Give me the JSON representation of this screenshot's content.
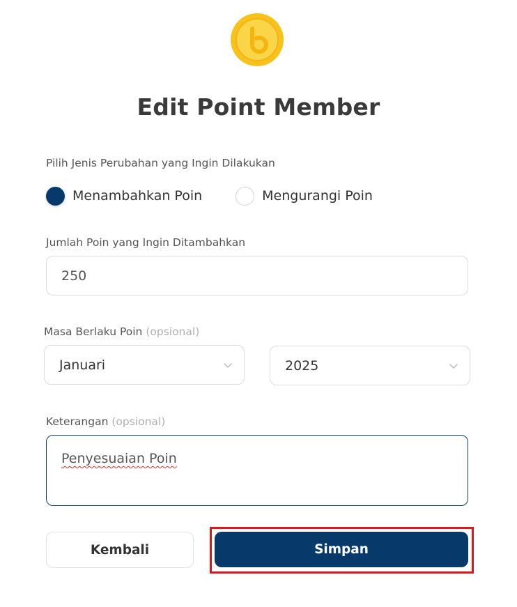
{
  "header": {
    "title": "Edit Point Member",
    "logo_icon": "coin-icon",
    "logo_colors": {
      "outer": "#F8C21C",
      "inner": "#FAD548",
      "symbol": "#F5B40E"
    }
  },
  "change_type": {
    "label": "Pilih Jenis Perubahan yang Ingin Dilakukan",
    "options": [
      {
        "label": "Menambahkan Poin",
        "checked": true
      },
      {
        "label": "Mengurangi Poin",
        "checked": false
      }
    ]
  },
  "amount": {
    "label": "Jumlah Poin yang Ingin Ditambahkan",
    "value": "250"
  },
  "validity": {
    "label": "Masa Berlaku Poin",
    "optional": "(opsional)",
    "month": "Januari",
    "year": "2025",
    "dropdown_icon": "chevron-down-icon"
  },
  "note": {
    "label": "Keterangan",
    "optional": "(opsional)",
    "value": "Penyesuaian Poin"
  },
  "actions": {
    "back_label": "Kembali",
    "save_label": "Simpan",
    "highlighted": "save"
  },
  "colors": {
    "primary": "#073A6B",
    "highlight": "#D71920"
  }
}
